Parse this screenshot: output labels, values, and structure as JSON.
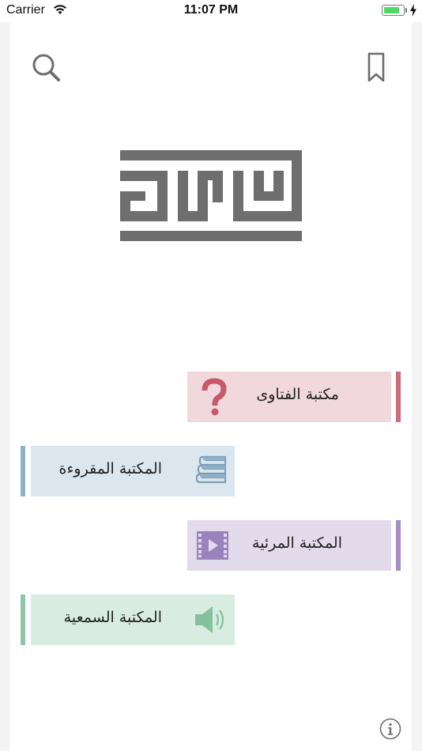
{
  "status_bar": {
    "carrier": "Carrier",
    "time": "11:07 PM",
    "battery_level": 0.85
  },
  "header": {
    "search_icon": "search-icon",
    "bookmark_icon": "bookmark-icon"
  },
  "logo": {
    "description_icon": "fatawa-kufic-logo"
  },
  "menu": {
    "items": [
      {
        "label": "مكتبة الفتاوى",
        "icon": "question-mark-icon",
        "color": "#cc6b7a",
        "bg": "#f1d8dc"
      },
      {
        "label": "المكتبة المقروءة",
        "icon": "books-icon",
        "color": "#8fb0c8",
        "bg": "#dbe6ee"
      },
      {
        "label": "المكتبة المرئية",
        "icon": "video-film-icon",
        "color": "#a48fc4",
        "bg": "#e3dbec"
      },
      {
        "label": "المكتبة السمعية",
        "icon": "speaker-icon",
        "color": "#8cc6a7",
        "bg": "#d8ece1"
      }
    ]
  },
  "footer": {
    "info_icon": "info-icon"
  }
}
